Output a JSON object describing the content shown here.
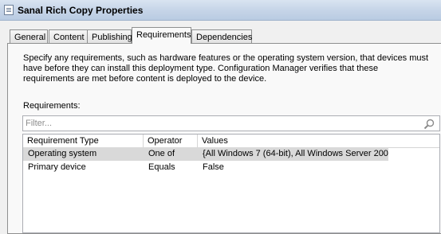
{
  "window": {
    "title": "Sanal Rich Copy Properties"
  },
  "tabs": [
    {
      "label": "General"
    },
    {
      "label": "Content"
    },
    {
      "label": "Publishing"
    },
    {
      "label": "Requirements",
      "active": true
    },
    {
      "label": "Dependencies"
    }
  ],
  "description": "Specify any requirements, such as hardware features or the operating system version, that devices must have before they can install this deployment type. Configuration Manager verifies that these requirements are met before content is deployed to the device.",
  "requirements_label": "Requirements:",
  "filter": {
    "placeholder": "Filter...",
    "value": ""
  },
  "table": {
    "columns": [
      "Requirement Type",
      "Operator",
      "Values"
    ],
    "rows": [
      {
        "type": "Operating system",
        "operator": "One of",
        "values": "{All Windows 7 (64-bit), All Windows Server 200...",
        "selected": true
      },
      {
        "type": "Primary device",
        "operator": "Equals",
        "values": "False",
        "selected": false
      }
    ]
  }
}
